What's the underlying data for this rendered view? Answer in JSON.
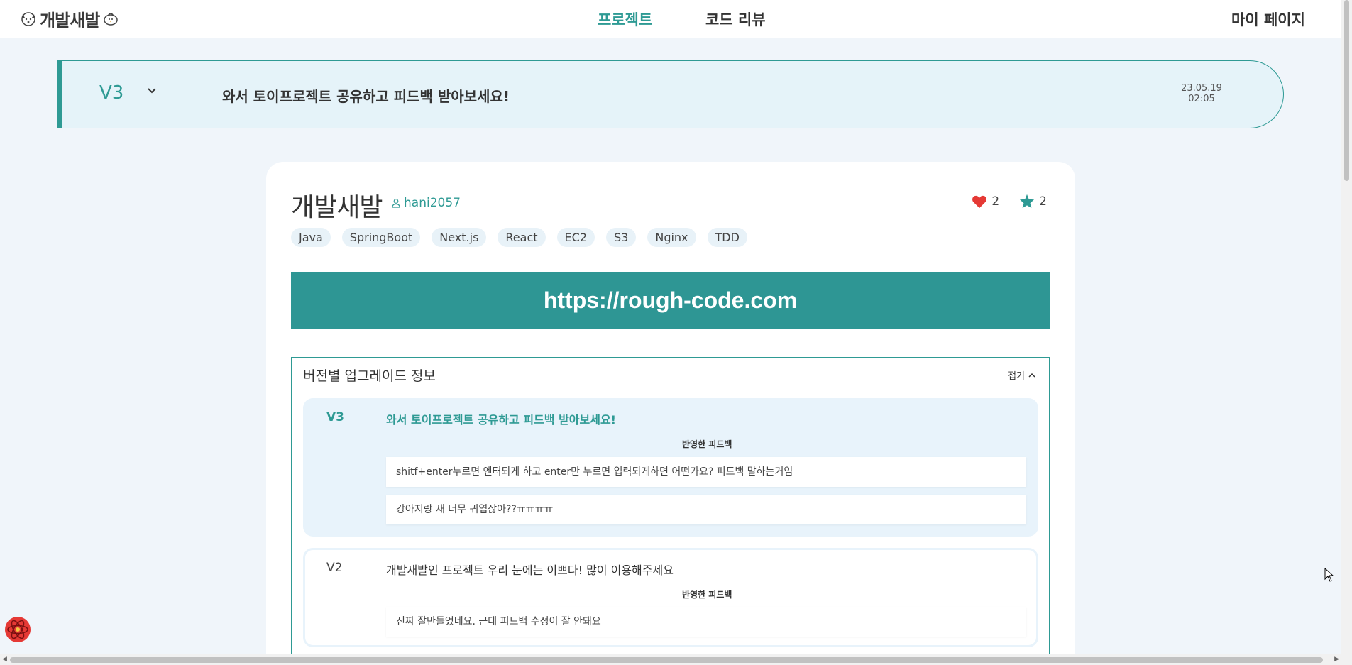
{
  "nav": {
    "logo_text": "개발새발",
    "links": [
      {
        "label": "프로젝트",
        "active": true
      },
      {
        "label": "코드 리뷰",
        "active": false
      }
    ],
    "mypage": "마이 페이지"
  },
  "banner": {
    "version": "V3",
    "title": "와서 토이프로젝트 공유하고 피드백 받아보세요!",
    "date": "23.05.19",
    "time": "02:05"
  },
  "project": {
    "title": "개발새발",
    "author": "hani2057",
    "likes": "2",
    "stars": "2",
    "tags": [
      "Java",
      "SpringBoot",
      "Next.js",
      "React",
      "EC2",
      "S3",
      "Nginx",
      "TDD"
    ],
    "url": "https://rough-code.com"
  },
  "upgrades": {
    "heading": "버전별 업그레이드 정보",
    "fold_label": "접기",
    "versions": [
      {
        "version": "V3",
        "title": "와서 토이프로젝트 공유하고 피드백 받아보세요!",
        "feedback_label": "반영한 피드백",
        "feedbacks": [
          "shitf+enter누르면 엔터되게 하고 enter만 누르면 입력되게하면 어떤가요? 피드백 말하는거임",
          "강아지랑 새 너무 귀엽잖아??ㅠㅠㅠㅠ"
        ]
      },
      {
        "version": "V2",
        "title": "개발새발인 프로젝트 우리 눈에는 이쁘다! 많이 이용해주세요",
        "feedback_label": "반영한 피드백",
        "feedbacks": [
          "진짜 잘만들었네요. 근데 피드백 수정이 잘 안돼요"
        ]
      }
    ]
  },
  "colors": {
    "accent": "#2e9a94",
    "banner_bg": "#e5f3f9",
    "heart": "#e53935"
  }
}
